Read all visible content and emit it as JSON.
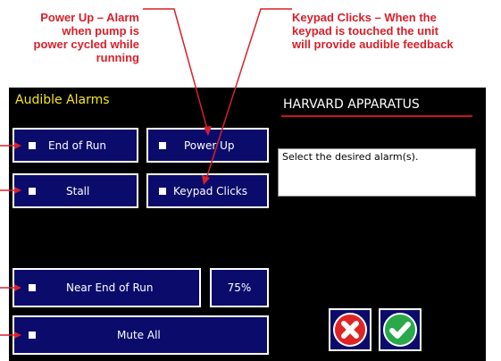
{
  "annotations": {
    "power_up": [
      "Power Up – Alarm",
      "when pump is",
      "power cycled while",
      "running"
    ],
    "keypad": [
      "Keypad Clicks – When the",
      "keypad is touched the unit",
      "will provide audible feedback"
    ]
  },
  "screen": {
    "title": "Audible Alarms",
    "brand": "HARVARD APPARATUS",
    "message": "Select the desired alarm(s).",
    "buttons": {
      "end_of_run": "End of Run",
      "power_up": "Power Up",
      "stall": "Stall",
      "keypad_clicks": "Keypad Clicks",
      "near_end_of_run": "Near End of Run",
      "near_end_percent": "75%",
      "mute_all": "Mute All"
    },
    "icons": {
      "cancel": "close-icon",
      "confirm": "checkmark-icon"
    }
  },
  "colors": {
    "annotation": "#d8202a",
    "button_bg": "#0b0b6b",
    "title": "#f5e51e",
    "brand_underline": "#c8141e",
    "cancel": "#e02424",
    "confirm": "#2aa84a"
  }
}
